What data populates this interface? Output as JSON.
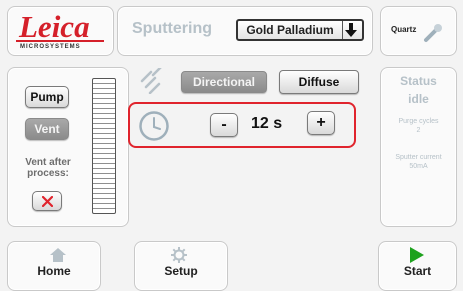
{
  "header": {
    "logo_text": "Leica",
    "logo_subtext": "MICROSYSTEMS",
    "mode_label": "Sputtering",
    "target_select": {
      "value": "Gold Palladium"
    },
    "quartz_label": "Quartz"
  },
  "left_panel": {
    "pump_label": "Pump",
    "vent_label": "Vent",
    "vent_after_label": "Vent after process:"
  },
  "process": {
    "directional_label": "Directional",
    "diffuse_label": "Diffuse",
    "minus_label": "-",
    "plus_label": "+",
    "time_value": "12 s"
  },
  "status": {
    "title": "Status",
    "state": "idle",
    "purge_label": "Purge cycles",
    "purge_value": "2",
    "current_label": "Sputter current",
    "current_value": "50mA"
  },
  "footer": {
    "home_label": "Home",
    "setup_label": "Setup",
    "start_label": "Start"
  },
  "colors": {
    "logo_red": "#d5202a",
    "highlight_red": "#e0242d",
    "start_green": "#1ea21e",
    "muted_text": "#b6c1c8"
  }
}
